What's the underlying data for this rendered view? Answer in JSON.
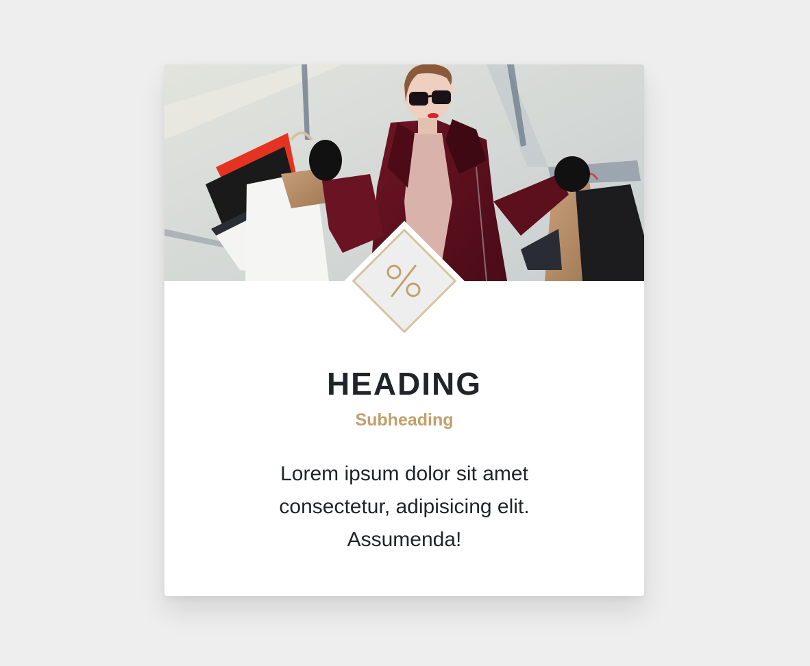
{
  "card": {
    "heading": "HEADING",
    "subheading": "Subheading",
    "body": "Lorem ipsum dolor sit amet consectetur, adipisicing elit. Assumenda!",
    "badge_icon": "percent-icon",
    "image": "woman-shopping-bags-photo"
  },
  "colors": {
    "page_background": "#eeeeee",
    "card_background": "#ffffff",
    "heading_color": "#212529",
    "accent": "#c0a16b",
    "badge_border": "#d6c3a1"
  }
}
